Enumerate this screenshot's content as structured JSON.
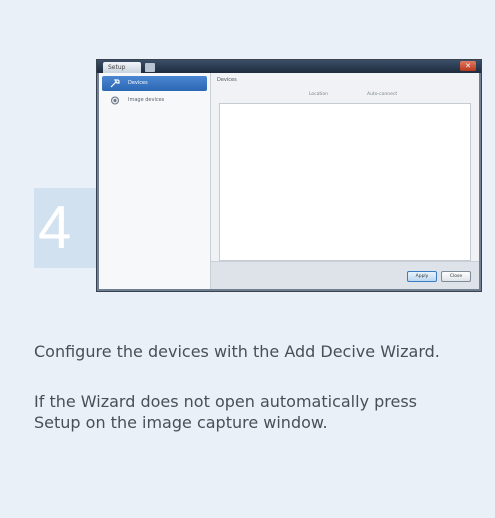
{
  "step": {
    "number": "4"
  },
  "screenshot": {
    "app_tab": "Setup",
    "close_glyph": "✕",
    "sidebar": {
      "items": [
        {
          "label": "Devices",
          "icon": "wrench-icon",
          "active": true
        },
        {
          "label": "Image devices",
          "icon": "camera-icon",
          "active": false
        }
      ]
    },
    "content": {
      "title": "Devices",
      "columns": [
        "Location",
        "Auto-connect"
      ]
    },
    "buttons": {
      "apply": "Apply",
      "close": "Close"
    }
  },
  "instructions": [
    "Configure the devices with the Add Decive Wizard.",
    "If the Wizard does not open automatically press Setup on the image capture window."
  ]
}
